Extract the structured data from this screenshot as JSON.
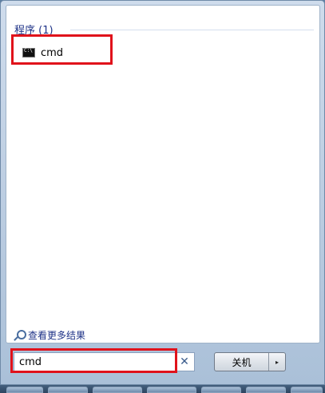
{
  "results": {
    "group_header": "程序 (1)",
    "items": [
      {
        "label": "cmd",
        "icon": "cmd-console-icon"
      }
    ],
    "see_more": "查看更多结果"
  },
  "search": {
    "value": "cmd",
    "clear_icon": "close-icon"
  },
  "shutdown": {
    "label": "关机",
    "arrow": "▸"
  },
  "colors": {
    "highlight": "#e0121b",
    "link": "#1e3287"
  }
}
